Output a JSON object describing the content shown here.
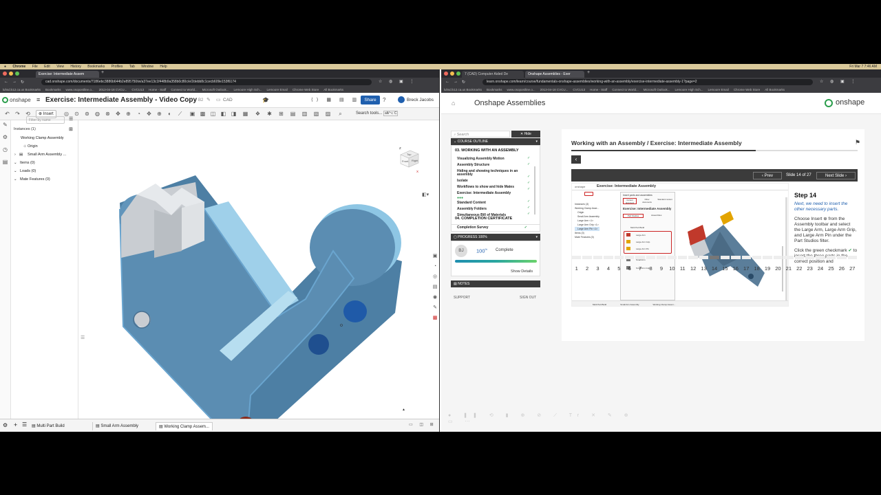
{
  "mac_menu": [
    "Chrome",
    "File",
    "Edit",
    "View",
    "History",
    "Bookmarks",
    "Profiles",
    "Tab",
    "Window",
    "Help"
  ],
  "clock": "Fri Mar 7  7:46 AM",
  "left": {
    "tab_title": "Exercise: Intermediate Assem",
    "url": "cad.onshape.com/documents/7186ebc3886b644b2e895750/w/a37ee13c1f448b9a358b0c80c/e/2debb8c1cecb609e153f6174",
    "bookmarks": [
      "luhsd.k12.ca.us Bookmarks",
      "Bookmarks",
      "www.osopostline.o...",
      "2013-04-18 CVCU...",
      "CVCU13",
      "Home - Staff",
      "Connect to World...",
      "Microsoft Outlook...",
      "Lemoore High Sch...",
      "Lemoore Email",
      "Chrome Web Store",
      "All Bookmarks"
    ],
    "brand": "onshape",
    "doc_title": "Exercise: Intermediate Assembly - Video Copy",
    "doc_version": "B2",
    "breadcrumb": "CAD",
    "share_label": "Share",
    "user": "Breck Jacobs",
    "insert_label": "Insert",
    "search_tools": "Search tools...",
    "search_shortcut": "alt/⌥ C",
    "tree": {
      "instances": "Instances (1)",
      "search_placeholder": "Filter by name",
      "items": [
        "Working Clamp Assembly",
        "Origin",
        "Small Arm Assembly ...",
        "Items (0)",
        "Loads (0)",
        "Mate Features (0)"
      ]
    },
    "cube": {
      "top": "Top",
      "front": "Front",
      "right": "Right",
      "z": "Z",
      "x": "X"
    },
    "bottom_tabs": [
      "Multi Part Build",
      "Small Arm Assembly",
      "Working Clamp Assem..."
    ]
  },
  "right": {
    "tab1": "7 (CAD) Computer Aided De",
    "tab2": "Onshape Assemblies - Exer",
    "url": "learn.onshape.com/learn/course/fundamentals-onshape-assemblies/working-with-an-assembly/exercise-intermediate-assembly-1?page=2",
    "bookmarks": [
      "luhsd.k12.ca.us Bookmarks",
      "Bookmarks",
      "www.osopostline.o...",
      "2013-04-18 CVCU...",
      "CVCU13",
      "Home - Staff",
      "Connect to World...",
      "Microsoft Outlook...",
      "Lemoore High Sch...",
      "Lemoore Email",
      "Chrome Web Store",
      "All Bookmarks"
    ],
    "header_title": "Onshape Assemblies",
    "logo": "onshape",
    "search_placeholder": "Search",
    "hide_label": "Hide",
    "course_outline": "COURSE OUTLINE",
    "section3": "03. WORKING WITH AN ASSEMBLY",
    "lessons": [
      "Visualizing Assembly Motion",
      "Assembly Structure",
      "Hiding and showing techniques in an assembly",
      "Isolate",
      "Workflows to show and hide Mates",
      "Exercise: Intermediate Assembly",
      "Standard Content",
      "Assembly Folders",
      "Simultaneous Bill of Materials"
    ],
    "section4": "04. COMPLETION CERTIFICATE",
    "completion_survey": "Completion Survey",
    "progress_label": "PROGRESS 100%",
    "initials": "BJ",
    "percent": "100",
    "percent_sign": "%",
    "complete": "Complete",
    "show_details": "Show Details",
    "notes": "NOTES",
    "support": "SUPPORT",
    "sign_out": "SIGN OUT",
    "lesson_title": "Working with an Assembly / Exercise: Intermediate Assembly",
    "prev": "Prev",
    "slide_counter": "Slide 14 of 27",
    "next": "Next Slide",
    "step_title": "Step 14",
    "step_intro": "Next, we need to insert the other necessary parts.",
    "step_body1a": "Choose Insert",
    "step_body1b": "from the Assembly toolbar and select the Large Arm, Large Arm Grip, and Large Arm Pin under the Part Studios filter.",
    "step_body2a": "Click the green checkmark",
    "step_body2b": "to insert the three parts in the correct position and",
    "thumb": {
      "title": "Exercise: Intermediate Assembly",
      "panel_title": "Insert parts and assemblies",
      "tabs": [
        "Current document",
        "Other documents",
        "Standard content"
      ],
      "filters": [
        "Part Studios",
        "Assemblies"
      ],
      "parts": [
        "Multi Part Build",
        "Large Arm",
        "Large Arm Grip",
        "Large Arm Pin",
        "Small Arm",
        "Small Arm Grip"
      ],
      "tree": [
        "Instances (3)",
        "Working Clamp Asse...",
        "Origin",
        "Small Arm Assembly",
        "Large Arm <1>",
        "Large Arm Grip <1>",
        "Large Arm Pin <1>",
        "Items (0)",
        "Mate Features (0)"
      ],
      "bottom_tabs": [
        "Multi Part Build",
        "Small Arm Assembly",
        "Working Clamp Assem..."
      ]
    },
    "pages": [
      "1",
      "2",
      "3",
      "4",
      "5",
      "6",
      "7",
      "8",
      "9",
      "10",
      "11",
      "12",
      "13",
      "14",
      "15",
      "16",
      "17",
      "18",
      "19",
      "20",
      "21",
      "22",
      "23",
      "24",
      "25",
      "26",
      "27"
    ],
    "current_page": 14
  },
  "colors": {
    "onshape_blue": "#1f5fae",
    "learn_green": "#2a9d4b",
    "part_blue": "#5b8db2",
    "part_gray": "#c9cdd2",
    "hole_red": "#8a2a1a",
    "dark_bar": "#3b3b3b"
  }
}
